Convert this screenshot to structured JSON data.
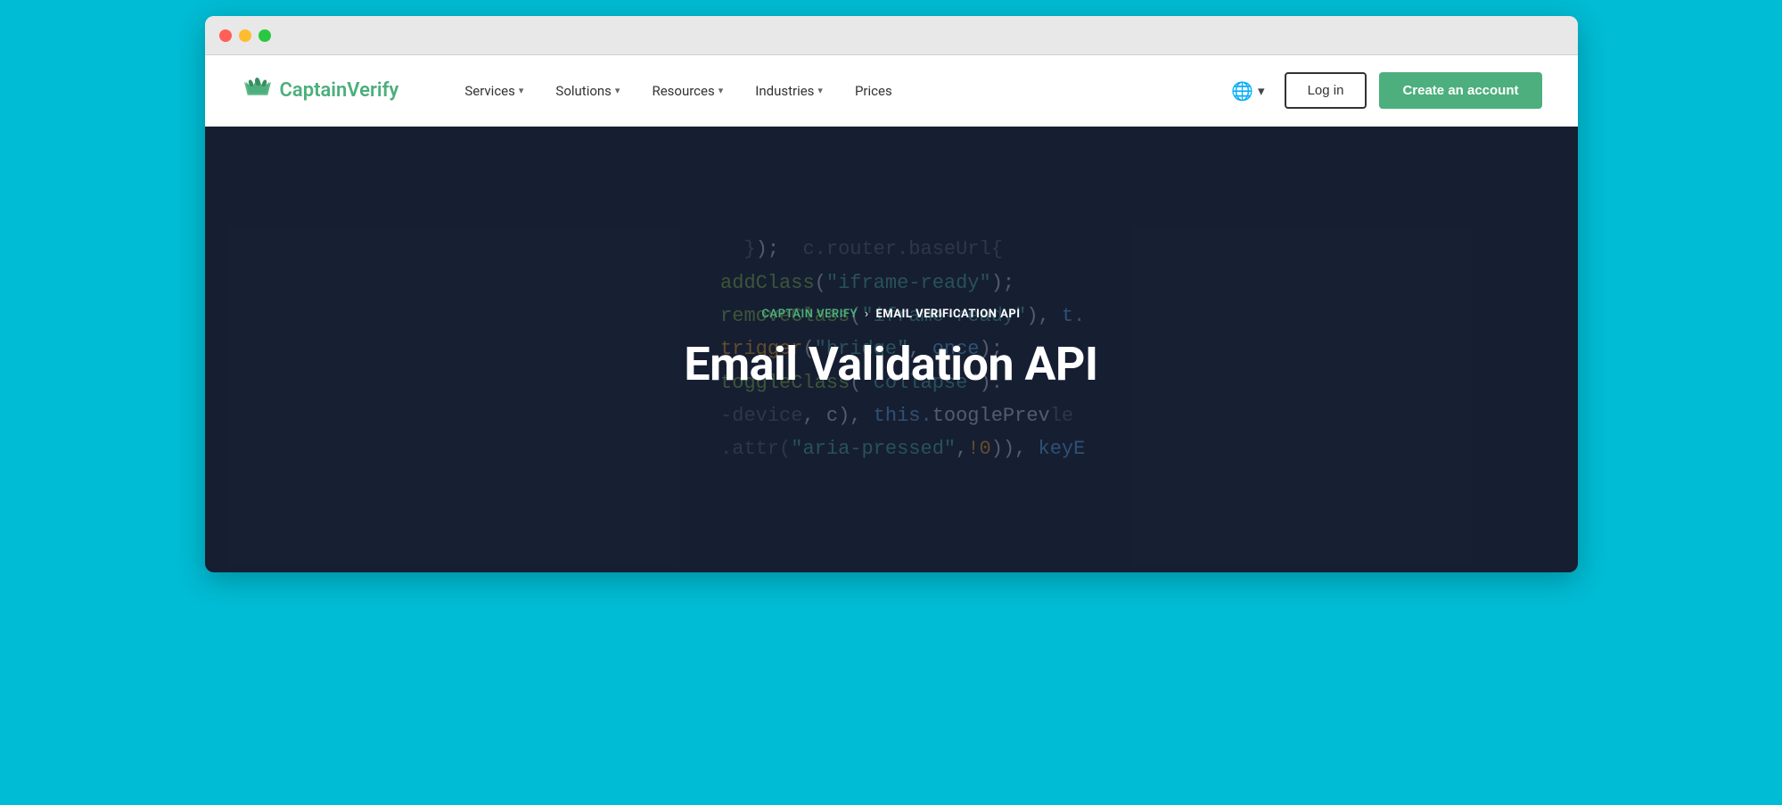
{
  "browser": {
    "traffic_lights": [
      "red",
      "yellow",
      "green"
    ]
  },
  "navbar": {
    "logo_text_plain": "Captain",
    "logo_text_accent": "Verify",
    "nav_items": [
      {
        "label": "Services",
        "has_dropdown": true
      },
      {
        "label": "Solutions",
        "has_dropdown": true
      },
      {
        "label": "Resources",
        "has_dropdown": true
      },
      {
        "label": "Industries",
        "has_dropdown": true
      },
      {
        "label": "Prices",
        "has_dropdown": false
      }
    ],
    "login_label": "Log in",
    "create_account_label": "Create an account",
    "lang_chevron": "▾"
  },
  "hero": {
    "breadcrumb_link": "CAPTAIN VERIFY",
    "breadcrumb_sep": "›",
    "breadcrumb_current": "EMAIL VERIFICATION API",
    "title": "Email Validation API"
  }
}
